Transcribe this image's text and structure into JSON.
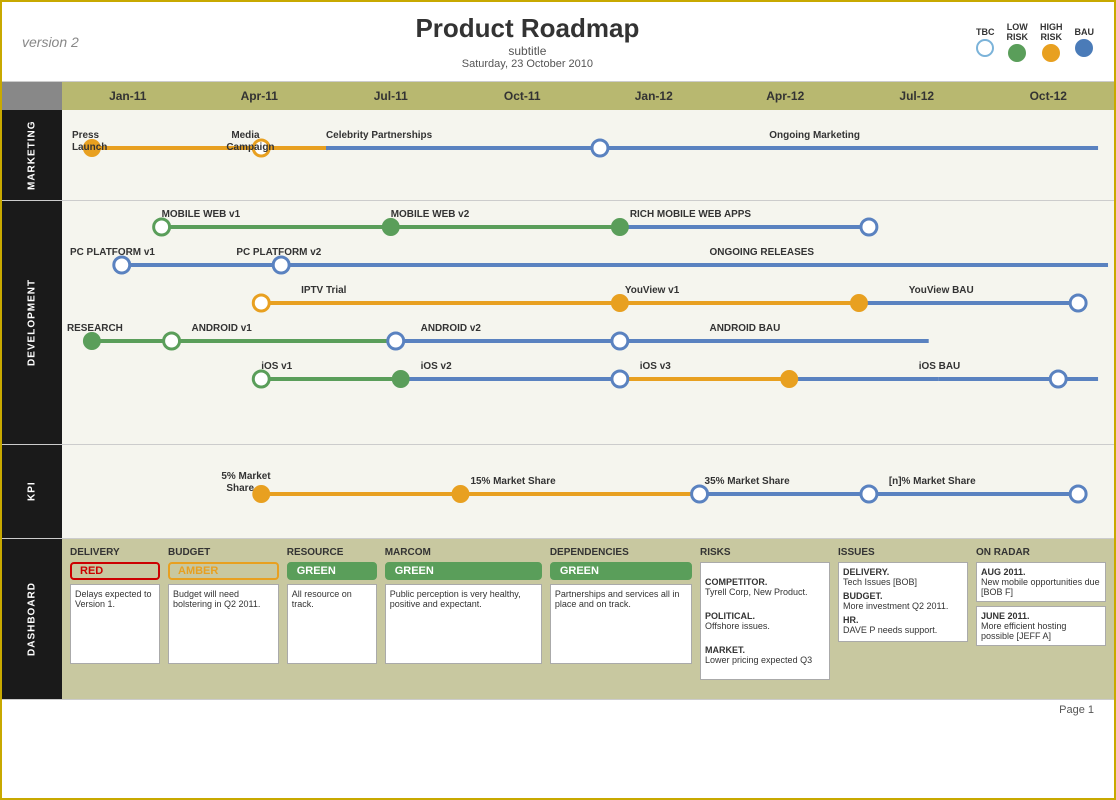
{
  "header": {
    "version": "version 2",
    "title": "Product Roadmap",
    "subtitle": "subtitle",
    "date": "Saturday, 23 October 2010",
    "legend": [
      {
        "label": "TBC",
        "type": "tbc"
      },
      {
        "label": "LOW\nRISK",
        "type": "low"
      },
      {
        "label": "HIGH\nRISK",
        "type": "high"
      },
      {
        "label": "BAU",
        "type": "bau"
      }
    ]
  },
  "months": [
    "Jan-11",
    "Apr-11",
    "Jul-11",
    "Oct-11",
    "Jan-12",
    "Apr-12",
    "Jul-12",
    "Oct-12"
  ],
  "sections": {
    "marketing": {
      "label": "MARKETING",
      "tracks": [
        {
          "label": "Press\nLaunch",
          "label2": "Media\nCampaign",
          "label3": "Celebrity Partnerships",
          "label4": "Ongoing Marketing"
        },
        {}
      ]
    },
    "development": {
      "label": "DEVELOPMENT"
    },
    "kpi": {
      "label": "KPI"
    }
  },
  "dashboard": {
    "label": "DASHBOARD",
    "delivery": {
      "title": "DELIVERY",
      "badge": "RED",
      "badge_type": "red",
      "text": "Delays expected to Version 1."
    },
    "budget": {
      "title": "BUDGET",
      "badge": "AMBER",
      "badge_type": "amber",
      "text": "Budget will need bolstering in Q2 2011."
    },
    "resource": {
      "title": "RESOURCE",
      "badge": "GREEN",
      "badge_type": "green",
      "text": "All resource on track."
    },
    "marcom": {
      "title": "MARCOM",
      "badge": "GREEN",
      "badge_type": "green",
      "text": "Public perception is very healthy, positive and expectant."
    },
    "dependencies": {
      "title": "DEPENDENCIES",
      "badge": "GREEN",
      "badge_type": "green",
      "text": "Partnerships and services all in place and on track."
    },
    "risks": {
      "title": "RISKS",
      "items": [
        "COMPETITOR.\nTyrell Corp, New Product.",
        "POLITICAL.\nOffshore issues.",
        "MARKET.\nLower pricing expected Q3"
      ]
    },
    "issues": {
      "title": "ISSUES",
      "items": [
        "DELIVERY.\nTech Issues [BOB]",
        "BUDGET.\nMore investment Q2 2011.",
        "HR.\nDAVE P needs support."
      ]
    },
    "on_radar": {
      "title": "ON RADAR",
      "items": [
        "AUG 2011.\nNew mobile opportunities due [BOB F]",
        "JUNE 2011.\nMore efficient hosting possible [JEFF A]"
      ]
    }
  },
  "footer": {
    "text": "Page 1"
  }
}
